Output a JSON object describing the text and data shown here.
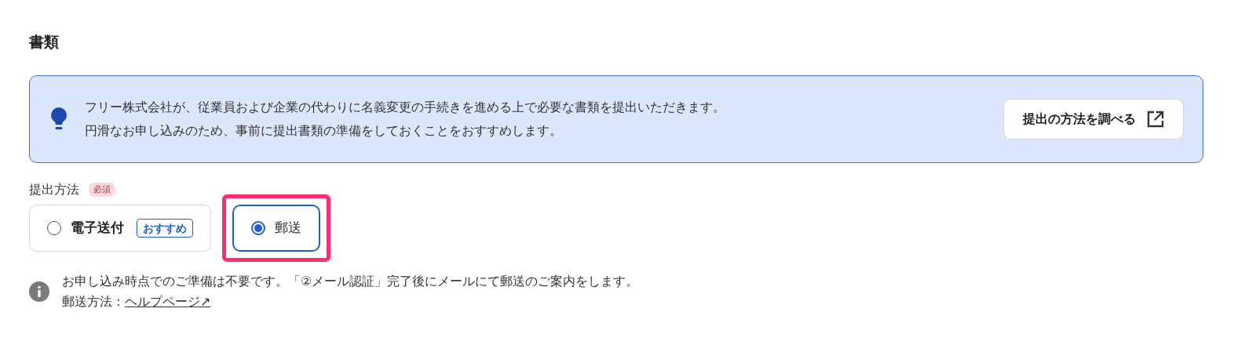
{
  "section_title": "書類",
  "notice": {
    "lines": [
      "フリー株式会社が、従業員および企業の代わりに名義変更の手続きを進める上で必要な書類を提出いただきます。",
      "円滑なお申し込みのため、事前に提出書類の準備をしておくことをおすすめします。"
    ],
    "button": "提出の方法を調べる"
  },
  "field": {
    "label": "提出方法",
    "required_badge": "必須",
    "options": [
      {
        "label": "電子送付",
        "badge": "おすすめ",
        "selected": false,
        "highlighted": false
      },
      {
        "label": "郵送",
        "selected": true,
        "highlighted": true
      }
    ]
  },
  "note": {
    "text": "お申し込み時点でのご準備は不要です。「②メール認証」完了後にメールにて郵送のご案内をします。",
    "link_prefix": "郵送方法：",
    "link": "ヘルプページ↗"
  }
}
